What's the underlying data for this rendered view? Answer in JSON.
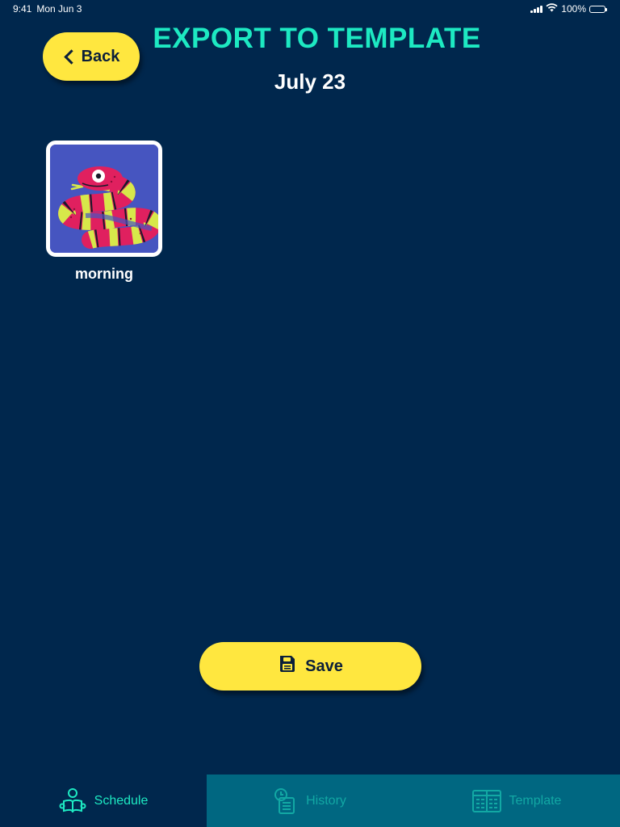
{
  "status_bar": {
    "time": "9:41",
    "date": "Mon Jun 3",
    "battery": "100%"
  },
  "header": {
    "back_label": "Back",
    "title": "EXPORT TO TEMPLATE",
    "subtitle": "July 23"
  },
  "activities": [
    {
      "label": "morning",
      "icon": "snake-icon"
    }
  ],
  "actions": {
    "save_label": "Save"
  },
  "tabs": [
    {
      "label": "Schedule",
      "icon": "child-reading-icon",
      "active": true
    },
    {
      "label": "History",
      "icon": "history-icon",
      "active": false
    },
    {
      "label": "Template",
      "icon": "template-icon",
      "active": false
    }
  ],
  "colors": {
    "background": "#00274d",
    "accent_teal": "#1de9c2",
    "button_yellow": "#ffe73f",
    "tab_bar_inactive": "#006781"
  }
}
